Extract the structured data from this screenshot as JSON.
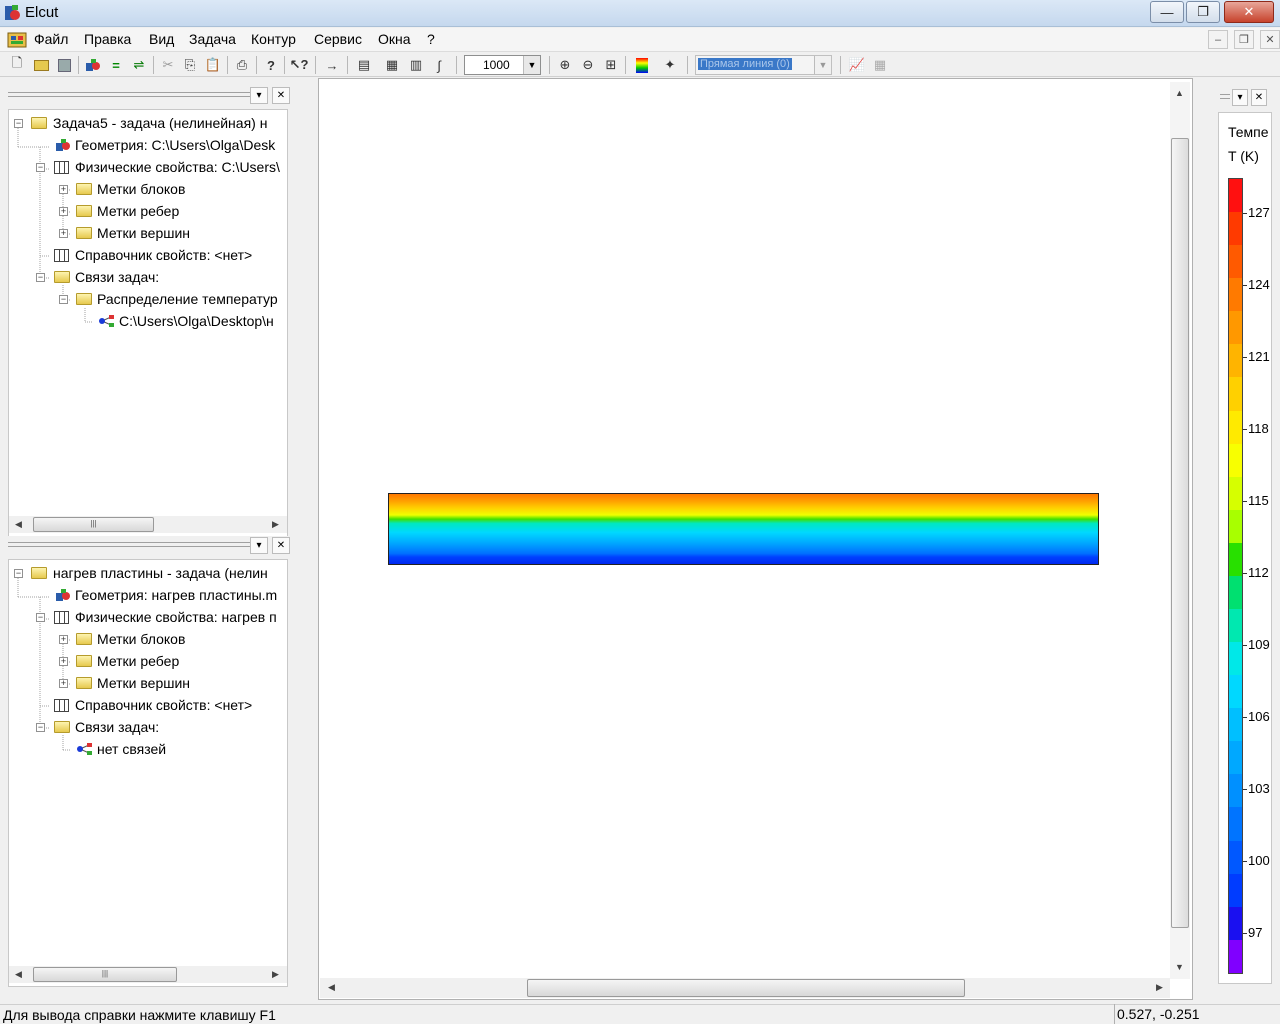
{
  "window": {
    "title": "Elcut"
  },
  "window_buttons": {
    "minimize": "—",
    "maximize": "❐",
    "close": "✕"
  },
  "menu": [
    "Файл",
    "Правка",
    "Вид",
    "Задача",
    "Контур",
    "Сервис",
    "Окна",
    "?"
  ],
  "mdi_buttons": {
    "minimize": "–",
    "restore": "❐",
    "close": "✕"
  },
  "toolbar": {
    "zoom_value": "1000",
    "line_type_value": "Прямая линия (0)"
  },
  "tree1": {
    "root": "Задача5 -  задача (нелинейная) н",
    "geometry": "Геометрия: C:\\Users\\Olga\\Desk",
    "physics": "Физические свойства: C:\\Users\\",
    "block_labels": "Метки блоков",
    "edge_labels": "Метки ребер",
    "vertex_labels": "Метки вершин",
    "library": "Справочник свойств: <нет>",
    "links": "Связи задач:",
    "temp_distribution": "Распределение температур",
    "link_path": "C:\\Users\\Olga\\Desktop\\н"
  },
  "tree2": {
    "root": "нагрев пластины -  задача (нелин",
    "geometry": "Геометрия: нагрев пластины.m",
    "physics": "Физические свойства: нагрев п",
    "block_labels": "Метки блоков",
    "edge_labels": "Метки ребер",
    "vertex_labels": "Метки вершин",
    "library": "Справочник свойств: <нет>",
    "links": "Связи задач:",
    "no_links": "нет связей"
  },
  "legend": {
    "title_line1": "Темпе",
    "title_line2": "T (K)",
    "ticks": [
      "127",
      "124",
      "121",
      "118",
      "115",
      "112",
      "109",
      "106",
      "103",
      "100",
      "97"
    ],
    "colors": [
      "#ff1010",
      "#ff3a00",
      "#ff5a00",
      "#ff7a00",
      "#ff9800",
      "#ffb400",
      "#ffd000",
      "#ffea00",
      "#f8ff00",
      "#d6ff00",
      "#a8ff00",
      "#28e000",
      "#00e070",
      "#00e8b0",
      "#00e8e8",
      "#00d8ff",
      "#00bfff",
      "#00a8ff",
      "#0090ff",
      "#0074ff",
      "#0058ff",
      "#003cff",
      "#1a10f0",
      "#8000ff"
    ]
  },
  "status": {
    "help_text": "Для вывода справки нажмите клавишу F1",
    "coords": "0.527, -0.251"
  }
}
